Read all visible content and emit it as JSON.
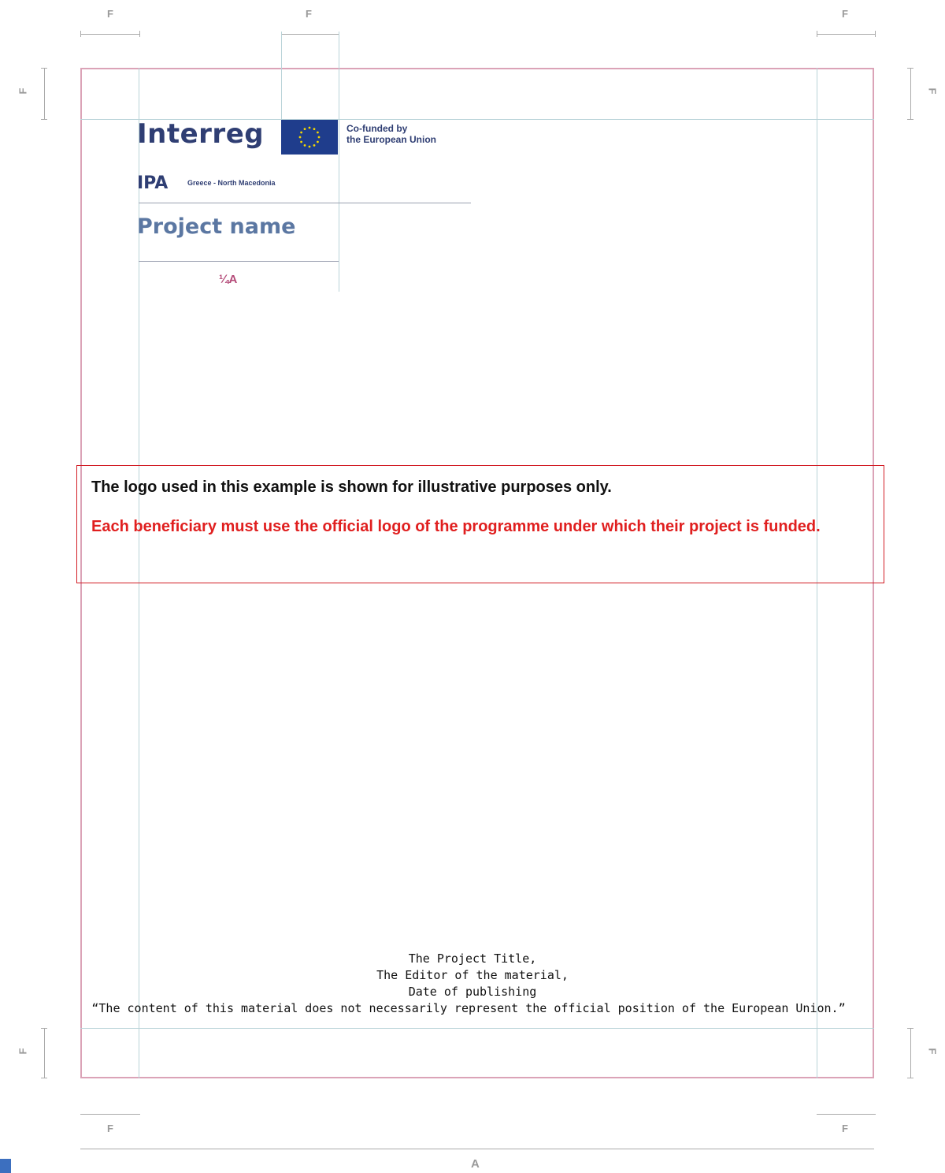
{
  "dimension_labels": {
    "margin": "F",
    "width": "A"
  },
  "logo": {
    "wordmark": "Interreg",
    "eu_text_line1": "Co-funded by",
    "eu_text_line2": "the European Union",
    "programme": "IPA",
    "programme_region": "Greece - North Macedonia",
    "project_name": "Project name",
    "height_ratio": "¼A"
  },
  "notice": {
    "line1": "The logo used in this example is shown for illustrative purposes only.",
    "line2": "Each beneficiary must use the official logo of the programme under which their project is funded."
  },
  "footer": {
    "project_title": "The Project Title,",
    "editor": "The Editor of the material,",
    "date": "Date of publishing",
    "disclaimer": "“The content of this material does not necessarily represent the official position of the European Union.”"
  },
  "colors": {
    "frame": "#dba3b7",
    "guides": "#b9d3d8",
    "logo_navy": "#2f3e73",
    "notice_border": "#d21d25",
    "notice_red": "#e01f1f"
  }
}
